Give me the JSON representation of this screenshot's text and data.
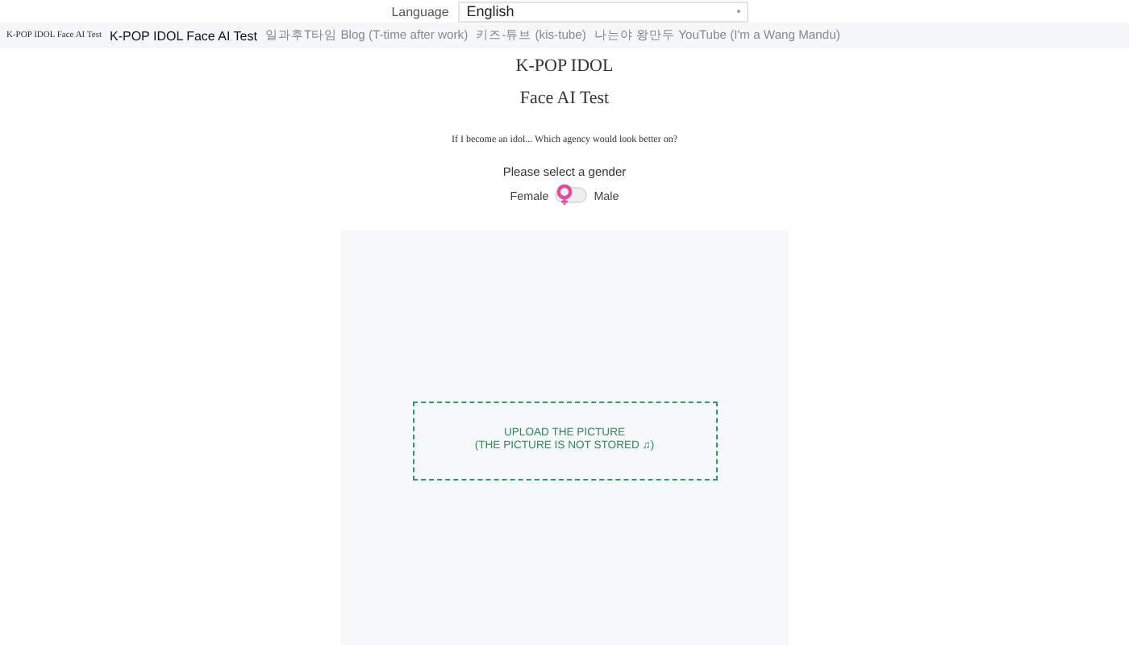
{
  "language": {
    "label": "Language",
    "value": "English"
  },
  "nav": {
    "brand": "K-POP IDOL Face AI Test",
    "links": [
      {
        "label": "K-POP IDOL Face AI Test",
        "selected": true
      },
      {
        "label": "일과후T타임 Blog (T-time after work)",
        "selected": false
      },
      {
        "label": "키즈-튜브 (kis-tube)",
        "selected": false
      },
      {
        "label": "나는야 왕만두 YouTube (I'm a Wang Mandu)",
        "selected": false
      }
    ]
  },
  "title_lines": [
    "K-POP IDOL",
    "Face AI Test"
  ],
  "subtitle": "If I become an idol... Which agency would look better on?",
  "gender": {
    "prompt": "Please select a gender",
    "off_label": "Female",
    "on_label": "Male",
    "switch": {
      "on": false
    }
  },
  "upload": {
    "lines": [
      "UPLOAD THE PICTURE",
      "(THE PICTURE IS NOT STORED ♫)"
    ]
  }
}
